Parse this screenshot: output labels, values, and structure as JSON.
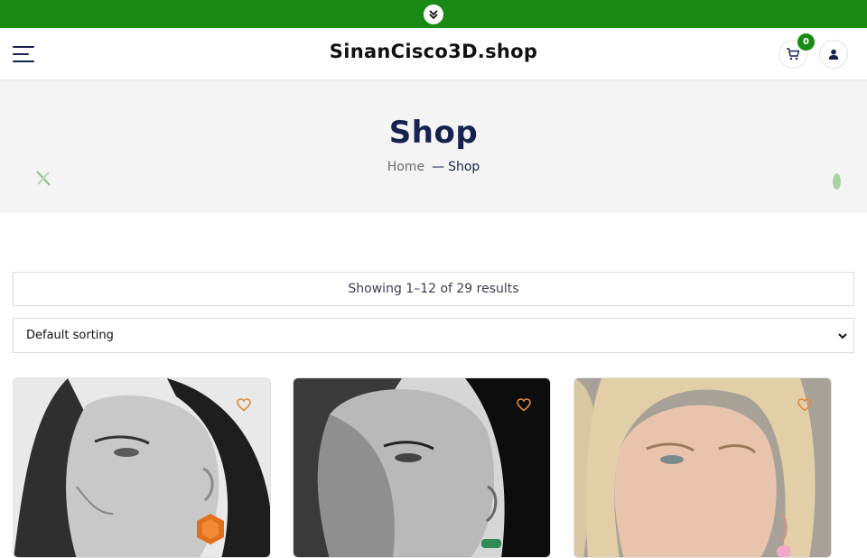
{
  "topbar": {
    "toggle_icon": "chevron-double-down-icon",
    "color": "#1b8a15"
  },
  "header": {
    "menu_icon": "hamburger-menu-icon",
    "site_title": "SinanCisco3D.shop",
    "cart_icon": "cart-icon",
    "cart_count": "0",
    "user_icon": "user-icon"
  },
  "banner": {
    "title": "Shop",
    "breadcrumb": {
      "home": "Home",
      "separator": "—",
      "current": "Shop"
    }
  },
  "shop": {
    "result_count": "Showing 1–12 of 29 results",
    "sorting": {
      "selected": "Default sorting"
    }
  },
  "products": [
    {
      "image": "woman with orange hexagon earring, black and white",
      "wishlist_icon": "heart-icon"
    },
    {
      "image": "woman with green earring, black and white",
      "wishlist_icon": "heart-icon"
    },
    {
      "image": "blonde woman with pink earring",
      "wishlist_icon": "heart-icon"
    }
  ],
  "colors": {
    "accent": "#1b8a15",
    "heading": "#16224f",
    "wishlist": "#e08a3c"
  }
}
